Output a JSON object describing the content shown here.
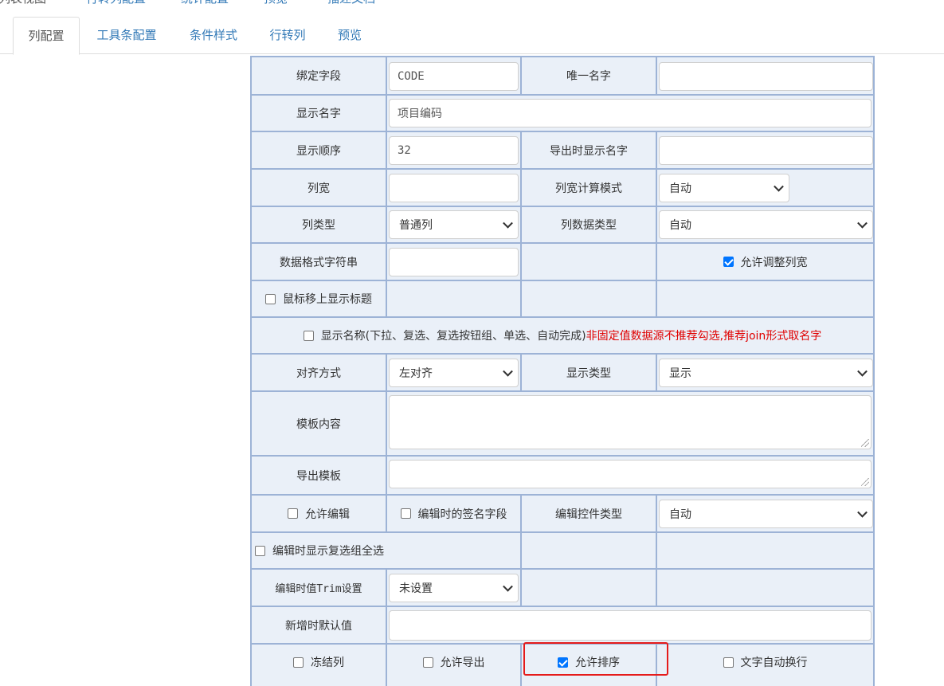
{
  "top_tabs": [
    "列表视图",
    "行转列配置",
    "统计配置",
    "预览",
    "描述文档"
  ],
  "sub_tabs": [
    "列配置",
    "工具条配置",
    "条件样式",
    "行转列",
    "预览"
  ],
  "form": {
    "bind_field_label": "绑定字段",
    "bind_field_value": "CODE",
    "unique_name_label": "唯一名字",
    "unique_name_value": "",
    "display_name_label": "显示名字",
    "display_name_value": "项目编码",
    "display_order_label": "显示顺序",
    "display_order_value": "32",
    "export_name_label": "导出时显示名字",
    "export_name_value": "",
    "col_width_label": "列宽",
    "col_width_value": "",
    "width_mode_label": "列宽计算模式",
    "width_mode_value": "自动",
    "col_type_label": "列类型",
    "col_type_value": "普通列",
    "col_data_type_label": "列数据类型",
    "col_data_type_value": "自动",
    "format_string_label": "数据格式字符串",
    "format_string_value": "",
    "allow_resize_label": "允许调整列宽",
    "hover_title_label": "鼠标移上显示标题",
    "show_name_label": "显示名称(下拉、复选、复选按钮组、单选、自动完成)",
    "show_name_warning": "非固定值数据源不推荐勾选,推荐join形式取名字",
    "align_label": "对齐方式",
    "align_value": "左对齐",
    "display_type_label": "显示类型",
    "display_type_value": "显示",
    "template_label": "模板内容",
    "export_template_label": "导出模板",
    "allow_edit_label": "允许编辑",
    "sign_field_label": "编辑时的签名字段",
    "edit_control_label": "编辑控件类型",
    "edit_control_value": "自动",
    "show_select_all_label": "编辑时显示复选组全选",
    "trim_label": "编辑时值Trim设置",
    "trim_value": "未设置",
    "default_value_label": "新增时默认值",
    "default_value_value": "",
    "freeze_label": "冻结列",
    "allow_export_label": "允许导出",
    "allow_sort_label": "允许排序",
    "wrap_label": "文字自动换行"
  },
  "checks": {
    "allow_resize": true,
    "hover_title": false,
    "show_name": false,
    "allow_edit": false,
    "sign_field": false,
    "show_select_all": false,
    "freeze": false,
    "allow_export": false,
    "allow_sort": true,
    "wrap": false
  },
  "colors": {
    "table_bg": "#eaf0f8",
    "table_border": "#9db3d6",
    "link": "#337ab7",
    "highlight": "#e51b1b",
    "checkbox_on": "#0075ff"
  }
}
